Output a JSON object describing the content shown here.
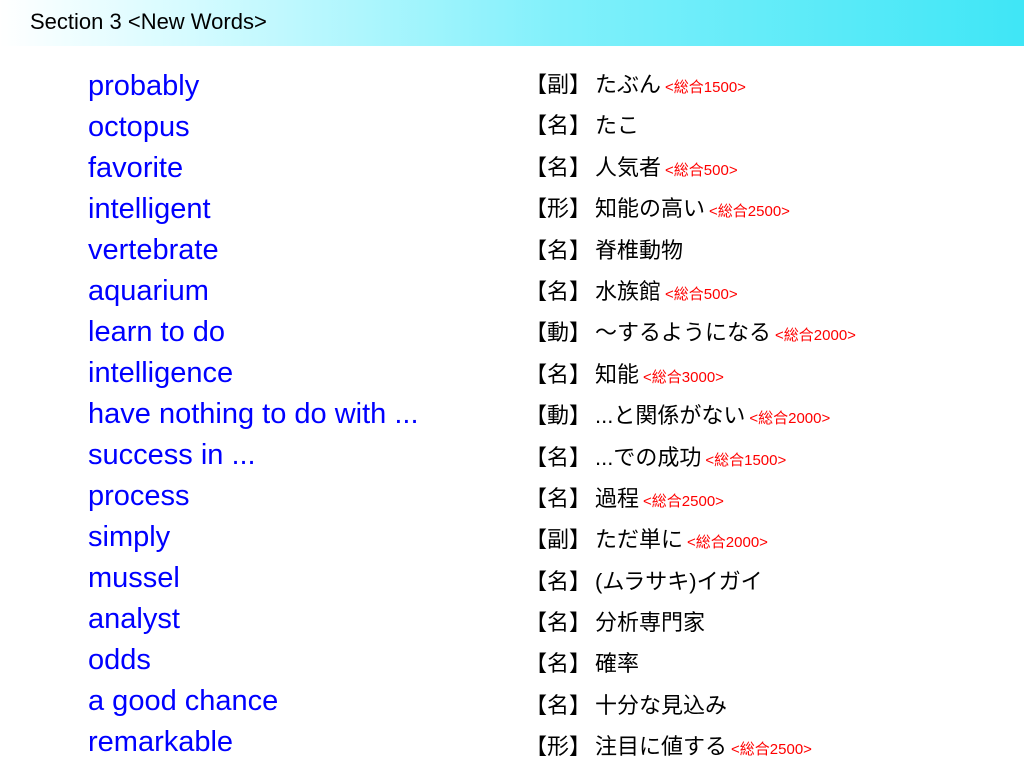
{
  "header": {
    "title": "Section 3 <New Words>"
  },
  "colors": {
    "word": "#0000ff",
    "level": "#ff0000",
    "header_gradient_end": "#3fe6f6"
  },
  "entries": [
    {
      "word": "probably",
      "pos": "【副】",
      "meaning": "たぶん",
      "level": "<総合1500>"
    },
    {
      "word": "octopus",
      "pos": "【名】",
      "meaning": "たこ",
      "level": ""
    },
    {
      "word": "favorite",
      "pos": "【名】",
      "meaning": "人気者",
      "level": "<総合500>"
    },
    {
      "word": "intelligent",
      "pos": "【形】",
      "meaning": "知能の高い",
      "level": "<総合2500>"
    },
    {
      "word": "vertebrate",
      "pos": "【名】",
      "meaning": "脊椎動物",
      "level": ""
    },
    {
      "word": "aquarium",
      "pos": "【名】",
      "meaning": "水族館",
      "level": "<総合500>"
    },
    {
      "word": "learn to do",
      "pos": "【動】",
      "meaning": "～するようになる",
      "level": "<総合2000>"
    },
    {
      "word": "intelligence",
      "pos": "【名】",
      "meaning": "知能",
      "level": "<総合3000>"
    },
    {
      "word": "have nothing to do with ...",
      "pos": "【動】",
      "meaning": "...と関係がない",
      "level": "<総合2000>"
    },
    {
      "word": "success in ...",
      "pos": "【名】",
      "meaning": "...での成功",
      "level": "<総合1500>"
    },
    {
      "word": "process",
      "pos": "【名】",
      "meaning": "過程",
      "level": "<総合2500>"
    },
    {
      "word": "simply",
      "pos": "【副】",
      "meaning": "ただ単に",
      "level": "<総合2000>"
    },
    {
      "word": "mussel",
      "pos": "【名】",
      "meaning": "(ムラサキ)イガイ",
      "level": ""
    },
    {
      "word": "analyst",
      "pos": "【名】",
      "meaning": "分析専門家",
      "level": ""
    },
    {
      "word": "odds",
      "pos": "【名】",
      "meaning": "確率",
      "level": ""
    },
    {
      "word": "a good chance",
      "pos": "【名】",
      "meaning": "十分な見込み",
      "level": ""
    },
    {
      "word": "remarkable",
      "pos": "【形】",
      "meaning": "注目に値する",
      "level": "<総合2500>"
    }
  ]
}
